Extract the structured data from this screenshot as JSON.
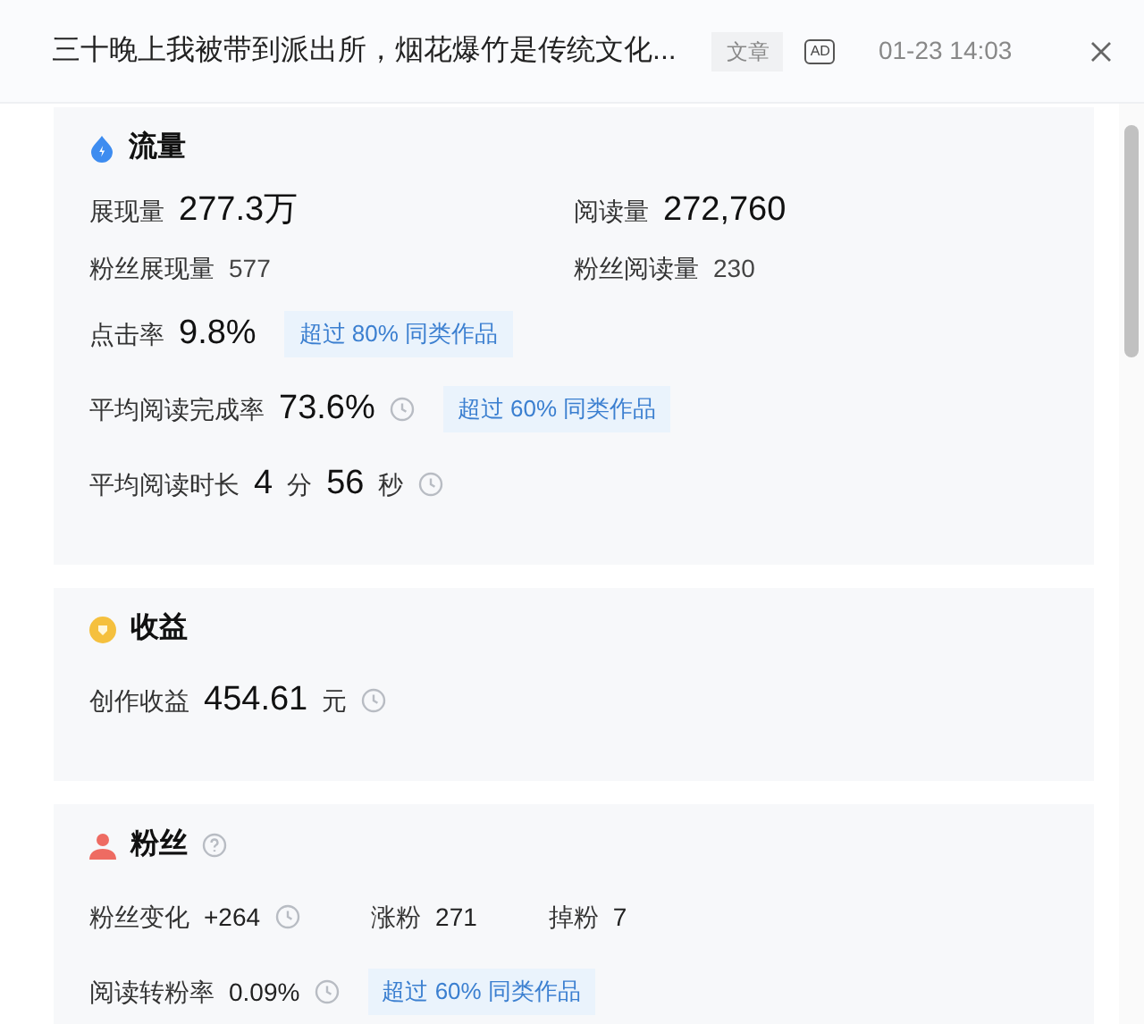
{
  "header": {
    "title": "三十晚上我被带到派出所，烟花爆竹是传统文化...",
    "type_badge": "文章",
    "ad_badge": "AD",
    "time": "01-23 14:03"
  },
  "sections": [
    {
      "title": "流量",
      "help": false,
      "rows": [
        {
          "kind": "columns",
          "columns": [
            [
              {
                "kind": "label",
                "text": "展现量"
              },
              {
                "kind": "big_value",
                "text": "277.3万"
              }
            ],
            [
              {
                "kind": "label",
                "text": "阅读量"
              },
              {
                "kind": "big_value",
                "text": "272,760"
              }
            ]
          ]
        },
        {
          "kind": "columns",
          "columns": [
            [
              {
                "kind": "label",
                "text": "粉丝展现量"
              },
              {
                "kind": "minor_value",
                "text": "577"
              }
            ],
            [
              {
                "kind": "label",
                "text": "粉丝阅读量"
              },
              {
                "kind": "minor_value",
                "text": "230"
              }
            ]
          ]
        },
        {
          "kind": "line",
          "items": [
            {
              "kind": "label",
              "text": "点击率"
            },
            {
              "kind": "big_value",
              "text": "9.8%"
            },
            {
              "kind": "badge",
              "text": "超过 80% 同类作品"
            }
          ]
        },
        {
          "kind": "line",
          "items": [
            {
              "kind": "label",
              "text": "平均阅读完成率"
            },
            {
              "kind": "big_value",
              "text": "73.6%"
            },
            {
              "kind": "clock"
            },
            {
              "kind": "badge",
              "text": "超过 60% 同类作品"
            }
          ]
        },
        {
          "kind": "line",
          "items": [
            {
              "kind": "label",
              "text": "平均阅读时长"
            },
            {
              "kind": "big_value",
              "text": "4"
            },
            {
              "kind": "unit",
              "text": "分"
            },
            {
              "kind": "big_value",
              "text": "56"
            },
            {
              "kind": "unit",
              "text": "秒"
            },
            {
              "kind": "clock"
            }
          ]
        }
      ]
    },
    {
      "title": "收益",
      "help": false,
      "rows": [
        {
          "kind": "line",
          "items": [
            {
              "kind": "label",
              "text": "创作收益"
            },
            {
              "kind": "big_value",
              "text": "454.61"
            },
            {
              "kind": "unit",
              "text": "元"
            },
            {
              "kind": "clock"
            }
          ]
        }
      ]
    },
    {
      "title": "粉丝",
      "help": true,
      "rows": [
        {
          "kind": "line",
          "items": [
            {
              "kind": "label",
              "text": "粉丝变化"
            },
            {
              "kind": "value",
              "text": "+264"
            },
            {
              "kind": "clock"
            },
            {
              "kind": "gap"
            },
            {
              "kind": "label",
              "text": "涨粉"
            },
            {
              "kind": "value",
              "text": "271"
            },
            {
              "kind": "gap"
            },
            {
              "kind": "label",
              "text": "掉粉"
            },
            {
              "kind": "value",
              "text": "7"
            }
          ]
        },
        {
          "kind": "line",
          "items": [
            {
              "kind": "label",
              "text": "阅读转粉率"
            },
            {
              "kind": "value",
              "text": "0.09%"
            },
            {
              "kind": "clock"
            },
            {
              "kind": "badge",
              "text": "超过 60% 同类作品"
            }
          ]
        }
      ]
    }
  ]
}
